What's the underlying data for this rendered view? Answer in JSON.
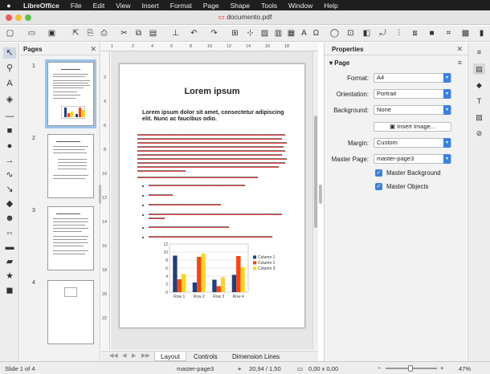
{
  "menubar": {
    "app": "LibreOffice",
    "items": [
      "File",
      "Edit",
      "View",
      "Insert",
      "Format",
      "Page",
      "Shape",
      "Tools",
      "Window",
      "Help"
    ]
  },
  "window": {
    "title": "documento.pdf"
  },
  "pages_panel": {
    "title": "Pages",
    "pages": [
      {
        "number": "1"
      },
      {
        "number": "2"
      },
      {
        "number": "3"
      },
      {
        "number": "4"
      }
    ]
  },
  "document": {
    "title": "Lorem ipsum",
    "subtitle": "Lorem ipsum dolor sit amet, consectetur adipiscing elit. Nunc ac faucibus odio."
  },
  "chart_data": {
    "type": "bar",
    "categories": [
      "Row 1",
      "Row 2",
      "Row 3",
      "Row 4"
    ],
    "series": [
      {
        "name": "Column 1",
        "values": [
          9.1,
          2.4,
          3.1,
          4.3
        ]
      },
      {
        "name": "Column 2",
        "values": [
          3.2,
          8.8,
          1.5,
          9.0
        ]
      },
      {
        "name": "Column 3",
        "values": [
          4.5,
          9.6,
          3.7,
          6.2
        ]
      }
    ],
    "ylim": [
      0,
      12
    ],
    "yticks": [
      "0",
      "2",
      "4",
      "6",
      "8",
      "10",
      "12"
    ],
    "colors": [
      "#1f3f7f",
      "#ff420e",
      "#ffd320"
    ],
    "legend": "right",
    "grid": true
  },
  "tabs": [
    "Layout",
    "Controls",
    "Dimension Lines"
  ],
  "statusbar": {
    "slide": "Slide 1 of 4",
    "master": "master-page3",
    "position": "20,94 / 1,50",
    "size": "0,00 x 0,00",
    "zoom": "47%"
  },
  "properties": {
    "title": "Properties",
    "section": "Page",
    "format_label": "Format:",
    "format_value": "A4",
    "orientation_label": "Orientation:",
    "orientation_value": "Portrait",
    "background_label": "Background:",
    "background_value": "None",
    "insert_image": "Insert Image...",
    "margin_label": "Margin:",
    "margin_value": "Custom",
    "master_label": "Master Page:",
    "master_value": "master-page3",
    "master_background": "Master Background",
    "master_objects": "Master Objects"
  },
  "icons": {
    "check": "✓",
    "dropdown": "▾",
    "close": "✕",
    "menu": "≡"
  }
}
